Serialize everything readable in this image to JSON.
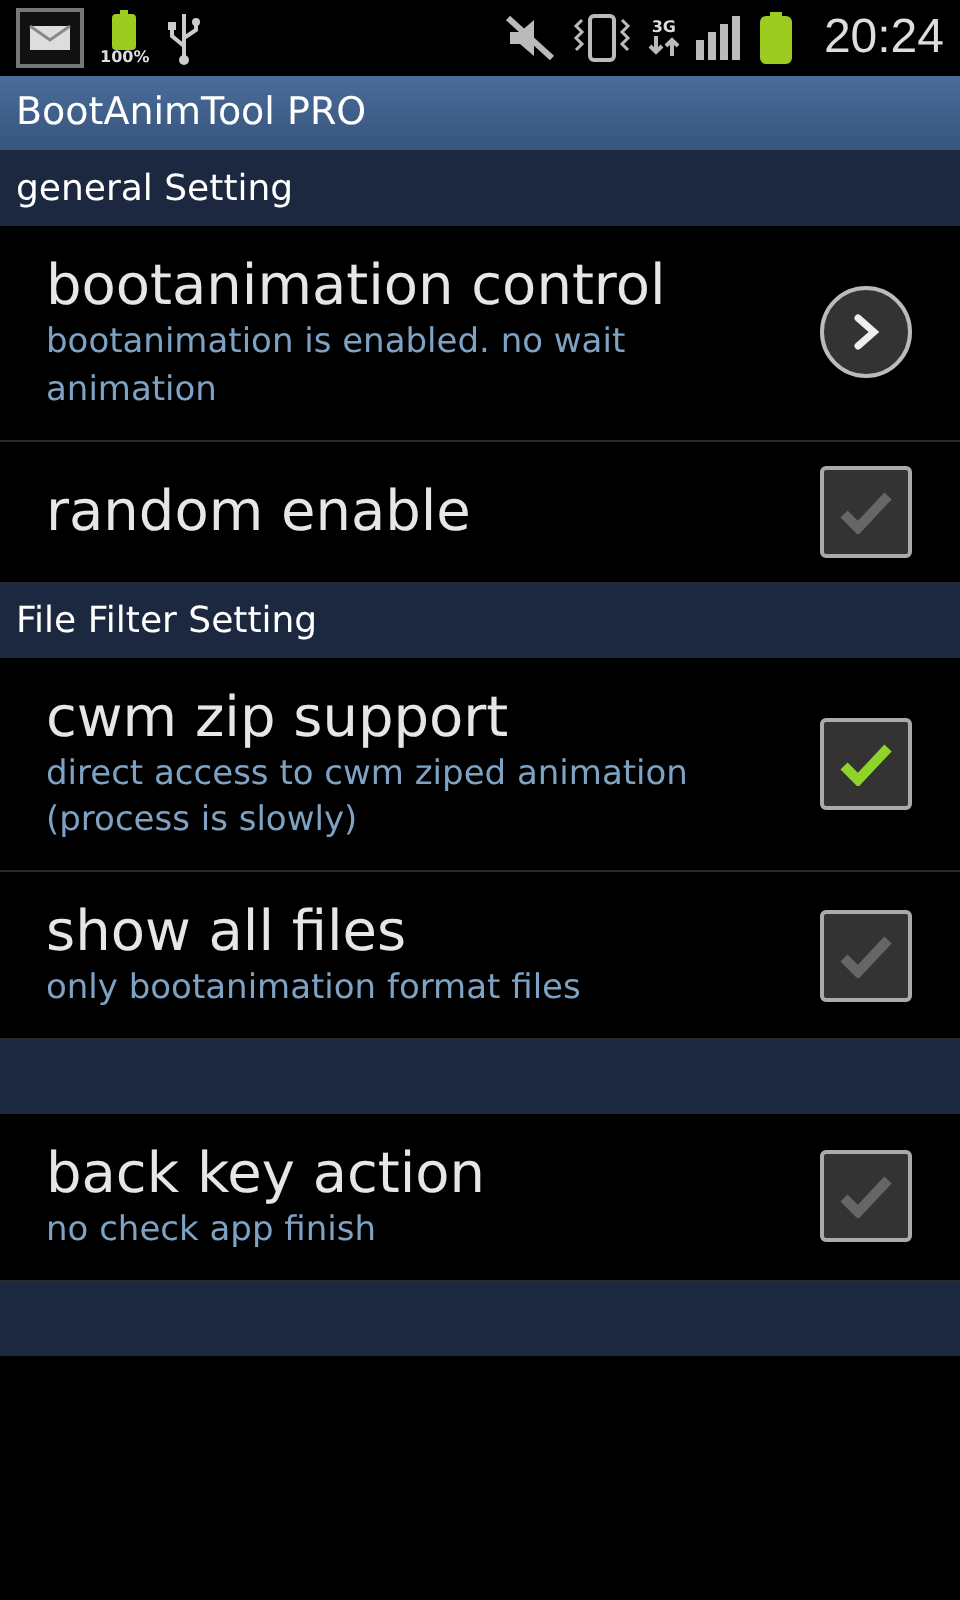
{
  "status_bar": {
    "battery_percent": "100%",
    "network": "3G",
    "time": "20:24"
  },
  "window": {
    "title": "BootAnimTool PRO"
  },
  "items": [
    {
      "kind": "header",
      "label": "general Setting"
    },
    {
      "kind": "arrow",
      "title": "bootanimation control",
      "summary": "bootanimation is enabled. no wait animation"
    },
    {
      "kind": "checkbox",
      "title": "random enable",
      "checked": false
    },
    {
      "kind": "header",
      "label": "File Filter Setting"
    },
    {
      "kind": "checkbox",
      "title": "cwm zip support",
      "summary": "direct access to cwm ziped animation (process is slowly)",
      "checked": true
    },
    {
      "kind": "checkbox",
      "title": "show all files",
      "summary": "only bootanimation format files",
      "checked": false
    },
    {
      "kind": "header"
    },
    {
      "kind": "checkbox",
      "title": "back key action",
      "summary": "no check app finish",
      "checked": false
    },
    {
      "kind": "header"
    }
  ]
}
